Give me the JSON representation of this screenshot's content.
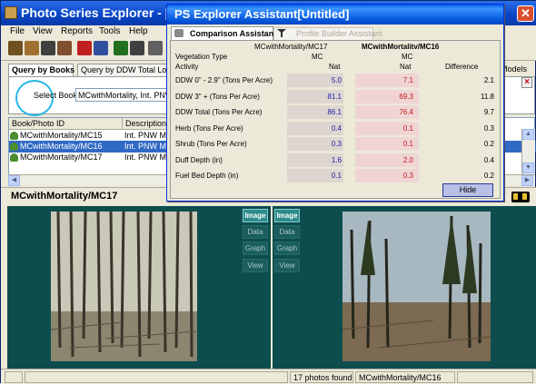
{
  "app": {
    "title": "Photo Series Explorer - [",
    "close": "✕"
  },
  "menu": [
    "File",
    "View",
    "Reports",
    "Tools",
    "Help"
  ],
  "query_tabs": {
    "by_books": "Query by Books",
    "by_ddw": "Query by DDW Total Load",
    "models": "Models"
  },
  "select_book": {
    "label": "Select Book",
    "value": "MCwithMortality, Int. PNW Mix"
  },
  "list": {
    "headers": [
      "Book/Photo ID",
      "Description"
    ],
    "rows": [
      {
        "id": "MCwithMortality/MC15",
        "desc": "Int. PNW Mixe"
      },
      {
        "id": "MCwithMortality/MC16",
        "desc": "Int. PNW Mixe"
      },
      {
        "id": "MCwithMortality/MC17",
        "desc": "Int. PNW Mixe"
      }
    ],
    "selected_index": 1
  },
  "photo_header": "MCwithMortality/MC17",
  "view_buttons": [
    "Image",
    "Data",
    "Graph",
    "View"
  ],
  "status": {
    "photos_found": "17 photos found",
    "current": "MCwithMortality/MC16"
  },
  "assistant": {
    "title": "PS Explorer Assistant[Untitled]",
    "tab_compare": "Comparison Assistant",
    "tab_builder": "Profile Builder Assistant",
    "col_left": "MCwithMortality/MC17",
    "col_right": "MCwithMortalitv/MC16",
    "veg_type_label": "Vegetation Type",
    "veg_left": "MC",
    "veg_right": "MC",
    "activity_label": "Activity",
    "act_left": "Nat",
    "act_right": "Nat",
    "diff_label": "Difference",
    "rows": [
      {
        "label": "DDW 0\" - 2.9\" (Tons Per Acre)",
        "left": "5.0",
        "right": "7.1",
        "diff": "2.1"
      },
      {
        "label": "DDW 3\" + (Tons Per Acre)",
        "left": "81.1",
        "right": "69.3",
        "diff": "11.8"
      },
      {
        "label": "DDW Total (Tons Per Acre)",
        "left": "86.1",
        "right": "76.4",
        "diff": "9.7"
      },
      {
        "label": "Herb (Tons Per Acre)",
        "left": "0.4",
        "right": "0.1",
        "diff": "0.3"
      },
      {
        "label": "Shrub (Tons Per Acre)",
        "left": "0.3",
        "right": "0.1",
        "diff": "0.2"
      },
      {
        "label": "Duff Depth (in)",
        "left": "1.6",
        "right": "2.0",
        "diff": "0.4"
      },
      {
        "label": "Fuel Bed Depth (in)",
        "left": "0.1",
        "right": "0.3",
        "diff": "0.2"
      }
    ],
    "hide": "Hide"
  },
  "colors": {
    "left_value": "#1a1aa8",
    "right_value": "#c01818",
    "left_bg": "#ddd6d0",
    "right_bg": "#f0d4d4",
    "panel_bg": "#0d4d4d",
    "selection": "#316ac5"
  }
}
